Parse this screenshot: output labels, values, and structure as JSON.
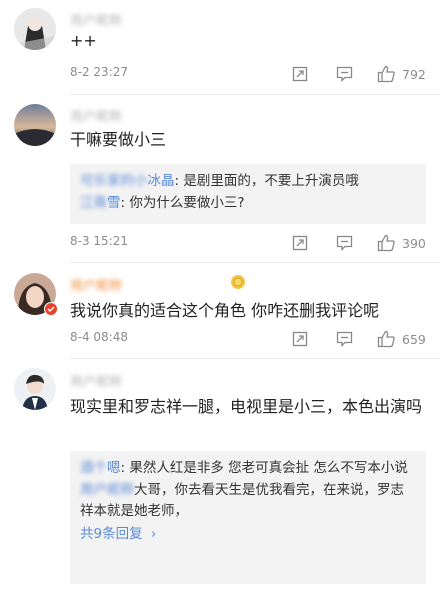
{
  "comments": [
    {
      "user": "用户昵称",
      "text": "++",
      "time": "8-2 23:27",
      "likes": "792"
    },
    {
      "user": "用户昵称",
      "text": "干嘛要做小三",
      "time": "8-3 15:21",
      "likes": "390",
      "replies": [
        {
          "user_hidden": "可乐家的小",
          "user_visible": "冰晶",
          "text": ": 是剧里面的，不要上升演员哦"
        },
        {
          "user_hidden": "江南",
          "user_visible": "雪",
          "text": ": 你为什么要做小三?"
        }
      ]
    },
    {
      "user": "用户昵称",
      "text": "我说你真的适合这个角色 你咋还删我评论呢",
      "time": "8-4 08:48",
      "likes": "659"
    },
    {
      "user": "用户昵称",
      "text": "现实里和罗志祥一腿，电视里是小三，本色出演吗",
      "replies": [
        {
          "user_hidden": "酒个",
          "user_visible": "嗯",
          "text": ": 果然人红是非多 您老可真会扯 怎么不写本小说"
        },
        {
          "user_hidden": "用户昵称",
          "user_visible": "",
          "text": "大哥，你去看天生是优我看完，在来说，罗志祥本就是她老师，"
        }
      ],
      "more_replies": "共9条回复"
    }
  ],
  "icons": {
    "repost": "share-icon",
    "comment": "comment-icon",
    "like": "thumb-up-icon"
  },
  "colors": {
    "link": "#5b8ad8",
    "meta": "#8c8c8c",
    "reply_bg": "#f3f3f3"
  }
}
